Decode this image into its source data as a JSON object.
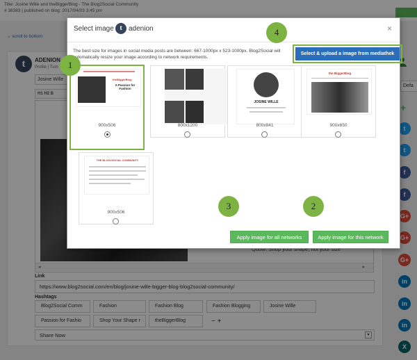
{
  "window": {
    "title_line": "Title: Josine Wille and theBiggerBlog - The Blog2Social Community",
    "meta_line": "# 38383 | published on blog: 2017/04/03 3:45 pm",
    "scroll_to_bottom": "scroll to bottom"
  },
  "post": {
    "account_name": "ADENION",
    "account_sub": "Profile | Tum",
    "name_field": "Josine Wille",
    "toolbar": "H1  H2  B",
    "quote": "Quote: Shop your shape, not your size",
    "link_label": "Link",
    "link_value": "https://www.blog2social.com/en/blog/josine-wille-bigger-blog-blog2social-community/",
    "hashtags_label": "Hashtags",
    "hashtags": [
      "Blog2Social Comm",
      "Fashion",
      "Fashion Blog",
      "Fashion Blogging",
      "Josine Wille",
      "Passion for Fashio",
      "Shop Your Shape r",
      "theBiggerBlog"
    ],
    "hashtag_controls": "− +",
    "share_select": "Share Now",
    "share_caret": "▾",
    "scroll_left": "◂",
    "scroll_right": "▸"
  },
  "sidebar_right": {
    "defa_field": "Defa",
    "networks": [
      "twitter",
      "twitter",
      "facebook",
      "facebook",
      "google-plus",
      "google-plus",
      "google-plus",
      "linkedin",
      "linkedin",
      "linkedin",
      "xing"
    ],
    "network_glyphs": [
      "t",
      "t",
      "f",
      "f",
      "G+",
      "G+",
      "G+",
      "in",
      "in",
      "in",
      "X"
    ],
    "colors": {
      "twitter": "#1da1f2",
      "facebook": "#3b5998",
      "google-plus": "#dd4b39",
      "linkedin": "#0077b5",
      "xing": "#026466"
    }
  },
  "modal": {
    "title": "Select image |",
    "account": "adenion",
    "network_logo": "t",
    "close": "×",
    "info": "The best size for images in social media posts are between: 667-1000px x 523-1000px. Blog2Social will automatically resize your image according to network requirements.",
    "upload_button": "Select & upload a image from mediathek",
    "images": [
      {
        "size": "900x506",
        "selected": true,
        "caption": "A Passion for Fashion"
      },
      {
        "size": "800x1200",
        "selected": false,
        "caption": ""
      },
      {
        "size": "800x841",
        "selected": false,
        "caption": "JOSINE WILLE"
      },
      {
        "size": "900x650",
        "selected": false,
        "caption": "theBiggerBlog"
      },
      {
        "size": "900x506",
        "selected": false,
        "caption": "THE BLOG2SOCIAL COMMUNITY"
      }
    ],
    "apply_all": "Apply image for all networks",
    "apply_this": "Apply image for this network",
    "thumb_brand": "theBiggerBlog",
    "thumb_brand_small": "the BiggerBlog"
  },
  "badges": [
    "1",
    "2",
    "3",
    "4"
  ],
  "colors": {
    "highlight_green": "#7cb342",
    "button_green": "#5cb85c",
    "button_blue": "#2a6ebb"
  }
}
